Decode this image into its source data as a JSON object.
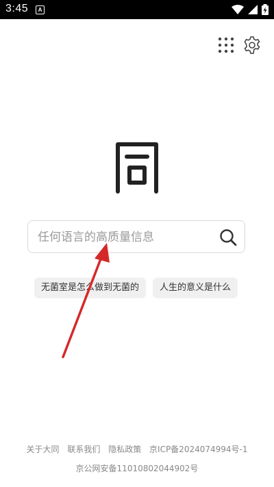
{
  "status_bar": {
    "time": "3:45",
    "notification_icon": "A",
    "icons": [
      "wifi-icon",
      "signal-icon",
      "battery-charging-icon"
    ]
  },
  "header": {
    "apps_icon": "grid-dots-icon",
    "settings_icon": "gear-icon"
  },
  "logo": {
    "icon": "tong-logo-icon"
  },
  "search": {
    "placeholder": "任何语言的高质量信息",
    "value": "",
    "button_icon": "search-icon"
  },
  "suggestions": [
    {
      "label": "无菌室是怎么做到无菌的"
    },
    {
      "label": "人生的意义是什么"
    }
  ],
  "footer": {
    "links": [
      {
        "label": "关于大同"
      },
      {
        "label": "联系我们"
      },
      {
        "label": "隐私政策"
      },
      {
        "label": "京ICP备2024074994号-1"
      }
    ],
    "public_security": "京公网安备11010802044902号"
  },
  "annotation": {
    "color": "#d42a2a"
  }
}
